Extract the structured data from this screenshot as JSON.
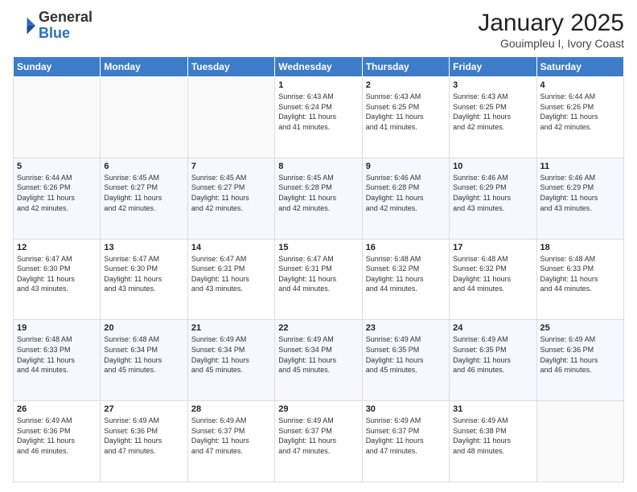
{
  "header": {
    "logo_general": "General",
    "logo_blue": "Blue",
    "title": "January 2025",
    "subtitle": "Gouimpleu I, Ivory Coast"
  },
  "weekdays": [
    "Sunday",
    "Monday",
    "Tuesday",
    "Wednesday",
    "Thursday",
    "Friday",
    "Saturday"
  ],
  "weeks": [
    [
      {
        "day": "",
        "info": ""
      },
      {
        "day": "",
        "info": ""
      },
      {
        "day": "",
        "info": ""
      },
      {
        "day": "1",
        "info": "Sunrise: 6:43 AM\nSunset: 6:24 PM\nDaylight: 11 hours\nand 41 minutes."
      },
      {
        "day": "2",
        "info": "Sunrise: 6:43 AM\nSunset: 6:25 PM\nDaylight: 11 hours\nand 41 minutes."
      },
      {
        "day": "3",
        "info": "Sunrise: 6:43 AM\nSunset: 6:25 PM\nDaylight: 11 hours\nand 42 minutes."
      },
      {
        "day": "4",
        "info": "Sunrise: 6:44 AM\nSunset: 6:26 PM\nDaylight: 11 hours\nand 42 minutes."
      }
    ],
    [
      {
        "day": "5",
        "info": "Sunrise: 6:44 AM\nSunset: 6:26 PM\nDaylight: 11 hours\nand 42 minutes."
      },
      {
        "day": "6",
        "info": "Sunrise: 6:45 AM\nSunset: 6:27 PM\nDaylight: 11 hours\nand 42 minutes."
      },
      {
        "day": "7",
        "info": "Sunrise: 6:45 AM\nSunset: 6:27 PM\nDaylight: 11 hours\nand 42 minutes."
      },
      {
        "day": "8",
        "info": "Sunrise: 6:45 AM\nSunset: 6:28 PM\nDaylight: 11 hours\nand 42 minutes."
      },
      {
        "day": "9",
        "info": "Sunrise: 6:46 AM\nSunset: 6:28 PM\nDaylight: 11 hours\nand 42 minutes."
      },
      {
        "day": "10",
        "info": "Sunrise: 6:46 AM\nSunset: 6:29 PM\nDaylight: 11 hours\nand 43 minutes."
      },
      {
        "day": "11",
        "info": "Sunrise: 6:46 AM\nSunset: 6:29 PM\nDaylight: 11 hours\nand 43 minutes."
      }
    ],
    [
      {
        "day": "12",
        "info": "Sunrise: 6:47 AM\nSunset: 6:30 PM\nDaylight: 11 hours\nand 43 minutes."
      },
      {
        "day": "13",
        "info": "Sunrise: 6:47 AM\nSunset: 6:30 PM\nDaylight: 11 hours\nand 43 minutes."
      },
      {
        "day": "14",
        "info": "Sunrise: 6:47 AM\nSunset: 6:31 PM\nDaylight: 11 hours\nand 43 minutes."
      },
      {
        "day": "15",
        "info": "Sunrise: 6:47 AM\nSunset: 6:31 PM\nDaylight: 11 hours\nand 44 minutes."
      },
      {
        "day": "16",
        "info": "Sunrise: 6:48 AM\nSunset: 6:32 PM\nDaylight: 11 hours\nand 44 minutes."
      },
      {
        "day": "17",
        "info": "Sunrise: 6:48 AM\nSunset: 6:32 PM\nDaylight: 11 hours\nand 44 minutes."
      },
      {
        "day": "18",
        "info": "Sunrise: 6:48 AM\nSunset: 6:33 PM\nDaylight: 11 hours\nand 44 minutes."
      }
    ],
    [
      {
        "day": "19",
        "info": "Sunrise: 6:48 AM\nSunset: 6:33 PM\nDaylight: 11 hours\nand 44 minutes."
      },
      {
        "day": "20",
        "info": "Sunrise: 6:48 AM\nSunset: 6:34 PM\nDaylight: 11 hours\nand 45 minutes."
      },
      {
        "day": "21",
        "info": "Sunrise: 6:49 AM\nSunset: 6:34 PM\nDaylight: 11 hours\nand 45 minutes."
      },
      {
        "day": "22",
        "info": "Sunrise: 6:49 AM\nSunset: 6:34 PM\nDaylight: 11 hours\nand 45 minutes."
      },
      {
        "day": "23",
        "info": "Sunrise: 6:49 AM\nSunset: 6:35 PM\nDaylight: 11 hours\nand 45 minutes."
      },
      {
        "day": "24",
        "info": "Sunrise: 6:49 AM\nSunset: 6:35 PM\nDaylight: 11 hours\nand 46 minutes."
      },
      {
        "day": "25",
        "info": "Sunrise: 6:49 AM\nSunset: 6:36 PM\nDaylight: 11 hours\nand 46 minutes."
      }
    ],
    [
      {
        "day": "26",
        "info": "Sunrise: 6:49 AM\nSunset: 6:36 PM\nDaylight: 11 hours\nand 46 minutes."
      },
      {
        "day": "27",
        "info": "Sunrise: 6:49 AM\nSunset: 6:36 PM\nDaylight: 11 hours\nand 47 minutes."
      },
      {
        "day": "28",
        "info": "Sunrise: 6:49 AM\nSunset: 6:37 PM\nDaylight: 11 hours\nand 47 minutes."
      },
      {
        "day": "29",
        "info": "Sunrise: 6:49 AM\nSunset: 6:37 PM\nDaylight: 11 hours\nand 47 minutes."
      },
      {
        "day": "30",
        "info": "Sunrise: 6:49 AM\nSunset: 6:37 PM\nDaylight: 11 hours\nand 47 minutes."
      },
      {
        "day": "31",
        "info": "Sunrise: 6:49 AM\nSunset: 6:38 PM\nDaylight: 11 hours\nand 48 minutes."
      },
      {
        "day": "",
        "info": ""
      }
    ]
  ]
}
